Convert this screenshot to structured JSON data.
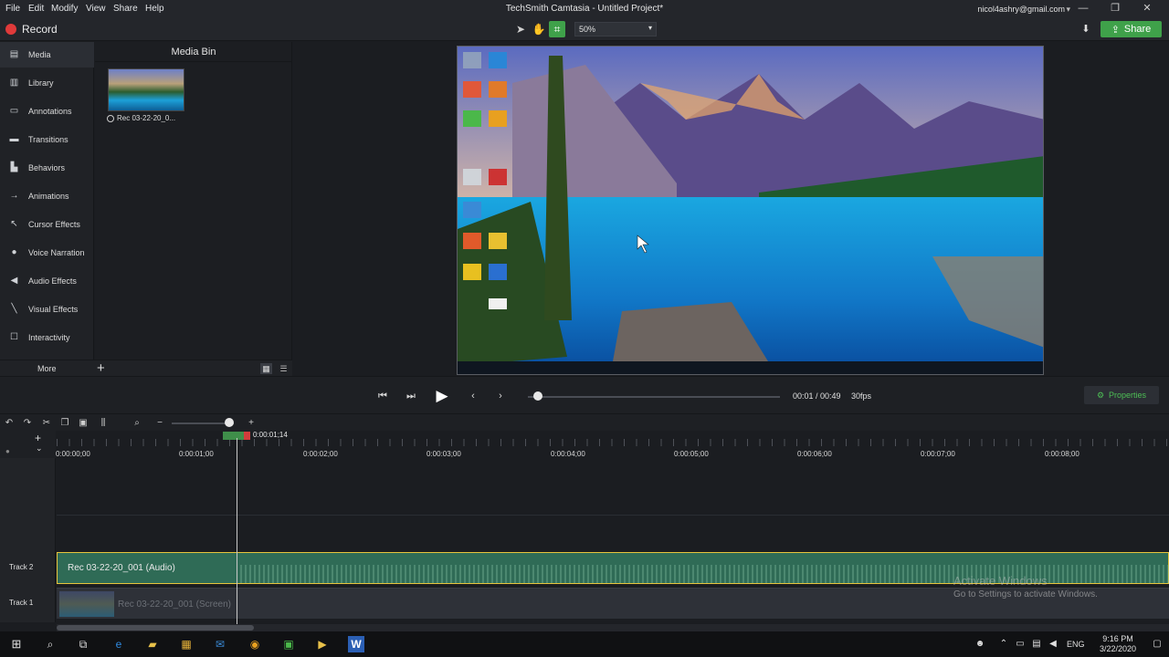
{
  "menubar": {
    "menus": [
      "File",
      "Edit",
      "Modify",
      "View",
      "Share",
      "Help"
    ],
    "title": "TechSmith Camtasia - Untitled Project*",
    "account": "nicol4ashry@gmail.com"
  },
  "toolbar": {
    "record_label": "Record",
    "zoom_value": "50%",
    "share_label": "Share"
  },
  "tools": [
    {
      "label": "Media",
      "icon": "film-icon"
    },
    {
      "label": "Library",
      "icon": "library-icon"
    },
    {
      "label": "Annotations",
      "icon": "annotation-icon"
    },
    {
      "label": "Transitions",
      "icon": "transition-icon"
    },
    {
      "label": "Behaviors",
      "icon": "behavior-icon"
    },
    {
      "label": "Animations",
      "icon": "animation-icon"
    },
    {
      "label": "Cursor Effects",
      "icon": "cursor-icon"
    },
    {
      "label": "Voice Narration",
      "icon": "microphone-icon"
    },
    {
      "label": "Audio Effects",
      "icon": "speaker-icon"
    },
    {
      "label": "Visual Effects",
      "icon": "wand-icon"
    },
    {
      "label": "Interactivity",
      "icon": "interactivity-icon"
    }
  ],
  "more_label": "More",
  "mediabin": {
    "title": "Media Bin",
    "item_label": "Rec 03-22-20_0..."
  },
  "playback": {
    "timecode": "00:01 / 00:49",
    "fps": "30fps",
    "properties_label": "Properties"
  },
  "timeline": {
    "playhead_time": "0:00:01;14",
    "ruler_labels": [
      "0:00:00;00",
      "0:00:01;00",
      "0:00:02;00",
      "0:00:03;00",
      "0:00:04;00",
      "0:00:05;00",
      "0:00:06;00",
      "0:00:07;00",
      "0:00:08;00"
    ],
    "tracks": [
      {
        "name": "Track 2",
        "clip": "Rec 03-22-20_001 (Audio)"
      },
      {
        "name": "Track 1",
        "clip": "Rec 03-22-20_001 (Screen)"
      }
    ]
  },
  "watermark": {
    "title": "Activate Windows",
    "subtitle": "Go to Settings to activate Windows."
  },
  "taskbar": {
    "lang": "ENG",
    "time": "9:16 PM",
    "date": "3/22/2020"
  }
}
